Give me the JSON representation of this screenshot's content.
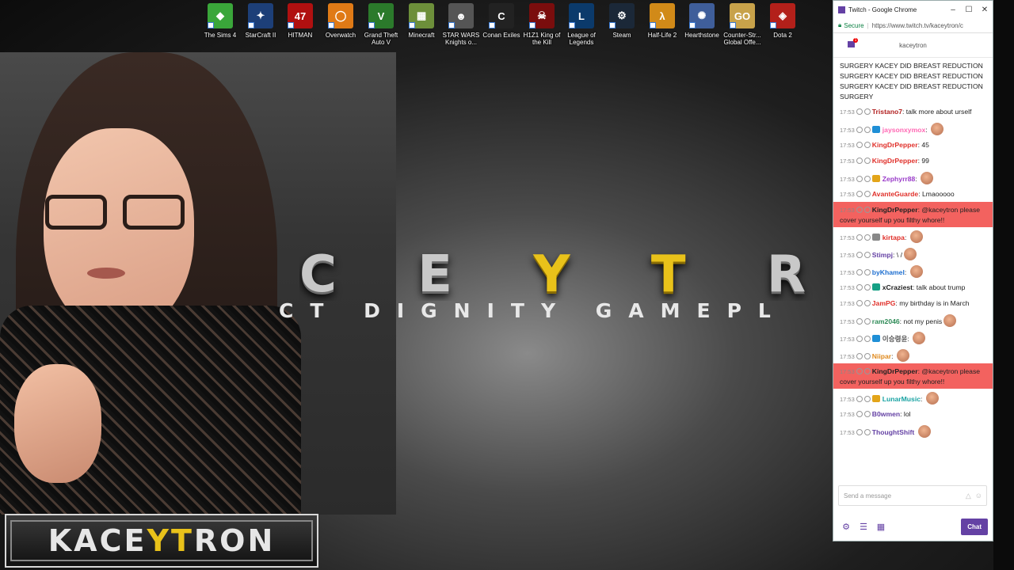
{
  "desktop": {
    "icons": [
      {
        "label": "The Sims 4",
        "color": "#3aa63a",
        "glyph": "◆"
      },
      {
        "label": "StarCraft II",
        "color": "#1d3f78",
        "glyph": "✦"
      },
      {
        "label": "HITMAN",
        "color": "#b01010",
        "glyph": "47"
      },
      {
        "label": "Overwatch",
        "color": "#e07a16",
        "glyph": "◯"
      },
      {
        "label": "Grand Theft Auto V",
        "color": "#2b7a2b",
        "glyph": "V"
      },
      {
        "label": "Minecraft",
        "color": "#6d8f3a",
        "glyph": "▦"
      },
      {
        "label": "STAR WARS Knights o...",
        "color": "#555555",
        "glyph": "☻"
      },
      {
        "label": "Conan Exiles",
        "color": "#222222",
        "glyph": "C"
      },
      {
        "label": "H1Z1 King of the Kill",
        "color": "#7a0d0d",
        "glyph": "☠"
      },
      {
        "label": "League of Legends",
        "color": "#0b3a6b",
        "glyph": "L"
      },
      {
        "label": "Steam",
        "color": "#1b2838",
        "glyph": "⚙"
      },
      {
        "label": "Half-Life 2",
        "color": "#d18a18",
        "glyph": "λ"
      },
      {
        "label": "Hearthstone",
        "color": "#3f5e9a",
        "glyph": "✺"
      },
      {
        "label": "Counter-Str... Global Offe...",
        "color": "#c8a24a",
        "glyph": "GO"
      },
      {
        "label": "Dota 2",
        "color": "#b3201a",
        "glyph": "◈"
      }
    ]
  },
  "wallpaper": {
    "title_before": "C E ",
    "title_accent": "Y T",
    "title_after": " R O",
    "subtitle": "CT DIGNITY GAMEPL"
  },
  "logo": {
    "before": "KACE",
    "accent": "YT",
    "after": "RON"
  },
  "browser": {
    "title": "Twitch - Google Chrome",
    "secure_label": "Secure",
    "url": "https://www.twitch.tv/kaceytron/c",
    "minimize": "–",
    "maximize": "☐",
    "close": "✕"
  },
  "chat": {
    "channel": "kaceytron",
    "notification_count": "1",
    "intro_text": "SURGERY  KACEY DID BREAST REDUCTION SURGERY  KACEY DID BREAST REDUCTION SURGERY  KACEY DID BREAST REDUCTION SURGERY",
    "messages": [
      {
        "time": "17:53",
        "user": "Tristano7",
        "color": "#b22222",
        "sep": ":",
        "text": "talk more about urself",
        "emote": false,
        "highlight": false
      },
      {
        "time": "17:53",
        "user": "jaysonxymox",
        "color": "#ff69b4",
        "sep": ":",
        "text": "",
        "emote": true,
        "highlight": false
      },
      {
        "time": "17:53",
        "user": "KingDrPepper",
        "color": "#e0302a",
        "sep": ":",
        "text": "45",
        "emote": false,
        "highlight": false
      },
      {
        "time": "17:53",
        "user": "KingDrPepper",
        "color": "#e0302a",
        "sep": ":",
        "text": "99",
        "emote": false,
        "highlight": false
      },
      {
        "time": "17:53",
        "user": "Zephyrr88",
        "color": "#9a3cc9",
        "sep": ":",
        "text": "",
        "emote": true,
        "highlight": false
      },
      {
        "time": "17:53",
        "user": "AvanteGuarde",
        "color": "#e0302a",
        "sep": ":",
        "text": "Lmaooooo",
        "emote": false,
        "highlight": false
      },
      {
        "time": "17:53",
        "user": "KingDrPepper",
        "color": "#222222",
        "sep": ":",
        "text": "@kaceytron please cover yourself up you filthy whore!!",
        "emote": false,
        "highlight": true
      },
      {
        "time": "17:53",
        "user": "kirtapa",
        "color": "#e0302a",
        "sep": ":",
        "text": "",
        "emote": true,
        "highlight": false
      },
      {
        "time": "17:53",
        "user": "Stimpj",
        "color": "#6441a4",
        "sep": ":",
        "text": "\\ /",
        "emote": true,
        "highlight": false
      },
      {
        "time": "17:53",
        "user": "byKhamel",
        "color": "#1e6fd0",
        "sep": ":",
        "text": "",
        "emote": true,
        "highlight": false
      },
      {
        "time": "17:53",
        "user": "xCraziest",
        "color": "#222222",
        "sep": ":",
        "text": "talk about trump",
        "emote": false,
        "highlight": false
      },
      {
        "time": "17:53",
        "user": "JamPG",
        "color": "#e0302a",
        "sep": ":",
        "text": "my birthday is in March",
        "emote": false,
        "highlight": false
      },
      {
        "time": "17:53",
        "user": "ram2046",
        "color": "#2e8b57",
        "sep": ":",
        "text": "not my penis",
        "emote": true,
        "highlight": false
      },
      {
        "time": "17:53",
        "user": "이승령윤",
        "color": "#555555",
        "sep": ":",
        "text": "",
        "emote": true,
        "highlight": false
      },
      {
        "time": "17:53",
        "user": "Niipar",
        "color": "#e08a1e",
        "sep": ":",
        "text": "",
        "emote": true,
        "highlight": false
      },
      {
        "time": "17:53",
        "user": "KingDrPepper",
        "color": "#222222",
        "sep": ":",
        "text": "@kaceytron please cover yourself up you filthy whore!!",
        "emote": false,
        "highlight": true
      },
      {
        "time": "17:53",
        "user": "LunarMusic",
        "color": "#1aa3a3",
        "sep": ":",
        "text": "",
        "emote": true,
        "highlight": false
      },
      {
        "time": "17:53",
        "user": "B0wmen",
        "color": "#6441a4",
        "sep": ":",
        "text": "lol",
        "emote": false,
        "highlight": false
      },
      {
        "time": "17:53",
        "user": "ThoughtShift",
        "color": "#6441a4",
        "sep": "",
        "text": "",
        "emote": true,
        "highlight": false
      }
    ],
    "input_placeholder": "Send a message",
    "send_label": "Chat",
    "settings_icon": "⚙",
    "list_icon": "☰",
    "bits_icon": "▦"
  }
}
